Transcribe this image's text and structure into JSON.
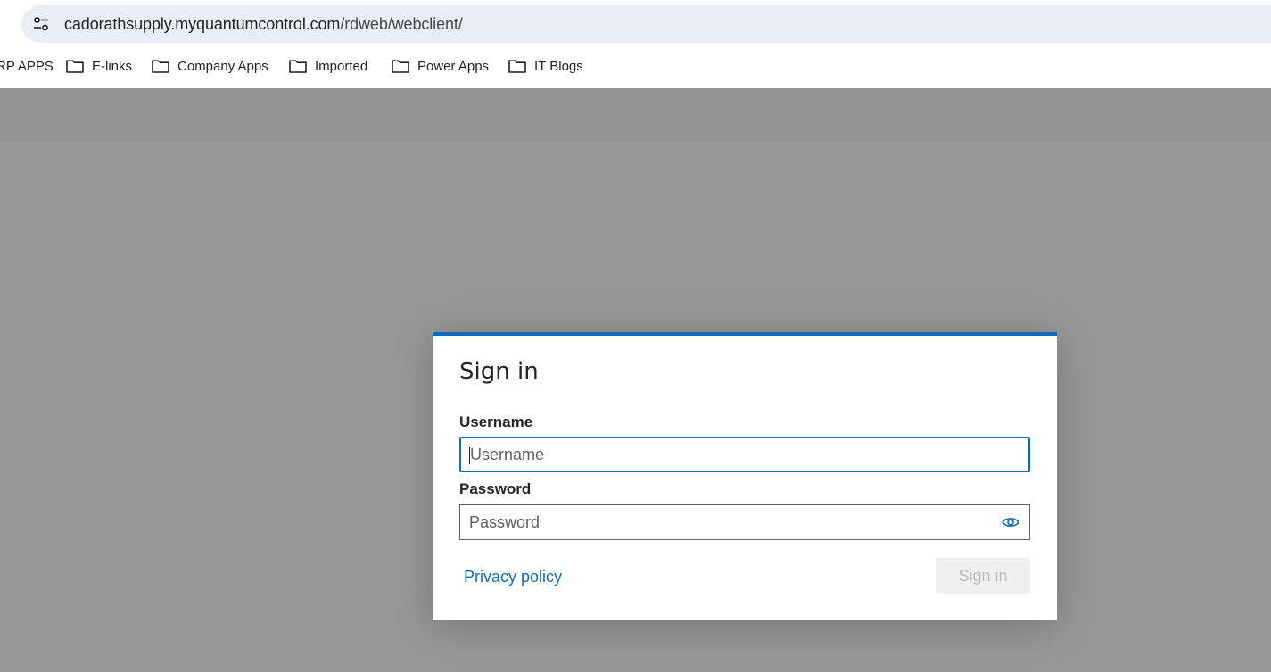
{
  "browser": {
    "url_host": "cadorathsupply.myquantumcontrol.com",
    "url_path": "/rdweb/webclient/",
    "site_info_icon": "tune-icon",
    "bookmarks": [
      {
        "label": "RP APPS",
        "icon": "none"
      },
      {
        "label": "E-links",
        "icon": "folder-icon"
      },
      {
        "label": "Company Apps",
        "icon": "folder-icon"
      },
      {
        "label": "Imported",
        "icon": "folder-icon"
      },
      {
        "label": "Power Apps",
        "icon": "folder-icon"
      },
      {
        "label": "IT Blogs",
        "icon": "folder-icon"
      }
    ]
  },
  "dialog": {
    "title": "Sign in",
    "username": {
      "label": "Username",
      "placeholder": "Username",
      "value": ""
    },
    "password": {
      "label": "Password",
      "placeholder": "Password",
      "value": "",
      "reveal_icon": "eye-icon"
    },
    "privacy_link": "Privacy policy",
    "signin_button": "Sign in",
    "accent_color": "#0f6cbd"
  }
}
